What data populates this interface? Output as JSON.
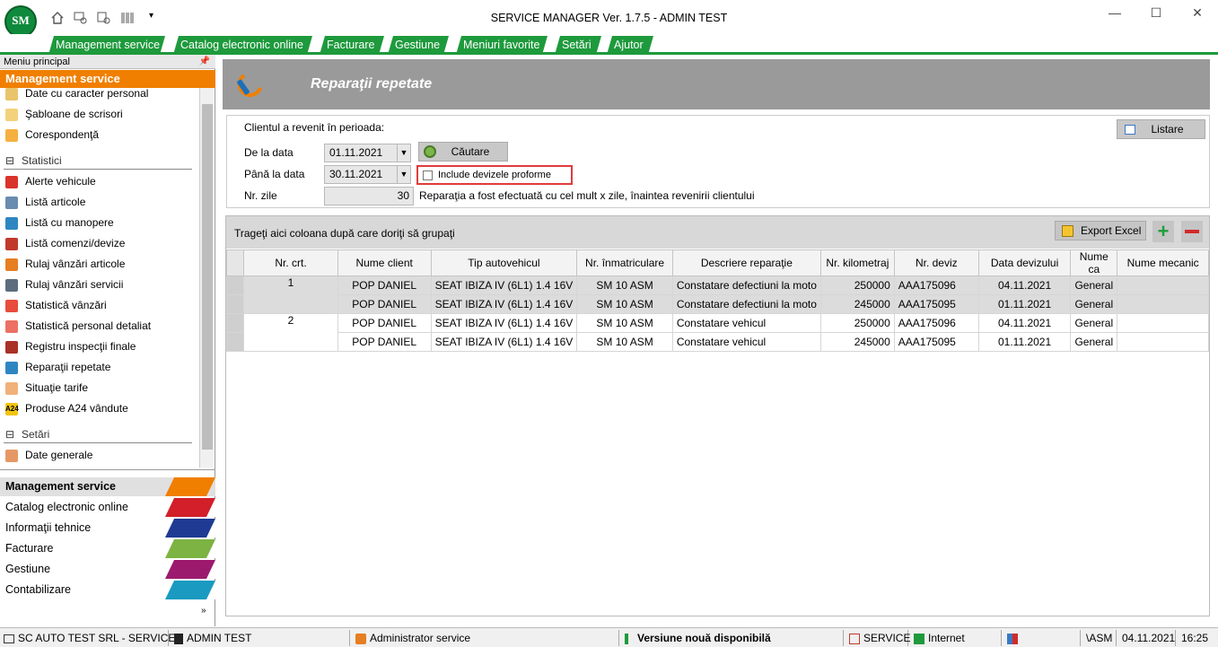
{
  "app": {
    "title": "SERVICE MANAGER Ver. 1.7.5 - ADMIN TEST",
    "logo_text": "SM"
  },
  "menubar": [
    "Management service",
    "Catalog electronic online",
    "Facturare",
    "Gestiune",
    "Meniuri favorite",
    "Setări",
    "Ajutor"
  ],
  "sidebar": {
    "header": "Meniu principal",
    "section": "Management service",
    "items_top": [
      "Date cu caracter personal",
      "Şabloane de scrisori",
      "Corespondenţă"
    ],
    "group_statistici": "Statistici",
    "items_stat": [
      "Alerte vehicule",
      "Listă articole",
      "Listă cu manopere",
      "Listă comenzi/devize",
      "Rulaj vânzări articole",
      "Rulaj vânzări servicii",
      "Statistică vânzări",
      "Statistică personal detaliat",
      "Registru inspecţii finale",
      "Reparaţii repetate",
      "Situaţie tarife",
      "Produse A24 vândute"
    ],
    "group_setari": "Setări",
    "items_set": [
      "Date generale"
    ],
    "nav": [
      "Management service",
      "Catalog electronic online",
      "Informaţii tehnice",
      "Facturare",
      "Gestiune",
      "Contabilizare"
    ]
  },
  "page": {
    "title": "Reparaţii repetate",
    "period_label": "Clientul a revenit în perioada:",
    "from_label": "De la data",
    "from_value": "01.11.2021",
    "to_label": "Până la data",
    "to_value": "30.11.2021",
    "search_button": "Căutare",
    "include_proforma": "Include devizele proforme",
    "days_label": "Nr. zile",
    "days_value": "30",
    "days_note": "Reparaţia a fost efectuată cu cel mult x zile, înaintea revenirii clientului",
    "list_button": "Listare"
  },
  "grid": {
    "group_hint": "Trageţi aici coloana după care doriţi să grupaţi",
    "export_button": "Export Excel",
    "columns": [
      "Nr. crt.",
      "Nume client",
      "Tip autovehicul",
      "Nr. înmatriculare",
      "Descriere reparaţie",
      "Nr. kilometraj",
      "Nr. deviz",
      "Data devizului",
      "Nume ca",
      "Nume mecanic"
    ],
    "rows": [
      {
        "nr": "1",
        "client": "POP DANIEL",
        "vehicle": "SEAT IBIZA IV (6L1) 1.4 16V",
        "plate": "SM 10 ASM",
        "desc": "Constatare defectiuni la moto",
        "km": "250000",
        "deviz": "AAA175096",
        "date": "04.11.2021",
        "ca": "General",
        "mech": ""
      },
      {
        "nr": "",
        "client": "POP DANIEL",
        "vehicle": "SEAT IBIZA IV (6L1) 1.4 16V",
        "plate": "SM 10 ASM",
        "desc": "Constatare defectiuni la moto",
        "km": "245000",
        "deviz": "AAA175095",
        "date": "01.11.2021",
        "ca": "General",
        "mech": ""
      },
      {
        "nr": "2",
        "client": "POP DANIEL",
        "vehicle": "SEAT IBIZA IV (6L1) 1.4 16V",
        "plate": "SM 10 ASM",
        "desc": "Constatare vehicul",
        "km": "250000",
        "deviz": "AAA175096",
        "date": "04.11.2021",
        "ca": "General",
        "mech": ""
      },
      {
        "nr": "",
        "client": "POP DANIEL",
        "vehicle": "SEAT IBIZA IV (6L1) 1.4 16V",
        "plate": "SM 10 ASM",
        "desc": "Constatare vehicul",
        "km": "245000",
        "deviz": "AAA175095",
        "date": "01.11.2021",
        "ca": "General",
        "mech": ""
      }
    ]
  },
  "status": {
    "company": "SC AUTO TEST SRL - SERVICE",
    "user": "ADMIN TEST",
    "role": "Administrator service",
    "update": "Versiune nouă disponibilă",
    "module": "SERVICE",
    "net": "Internet",
    "code": "\\ASM",
    "date": "04.11.2021",
    "time": "16:25"
  }
}
